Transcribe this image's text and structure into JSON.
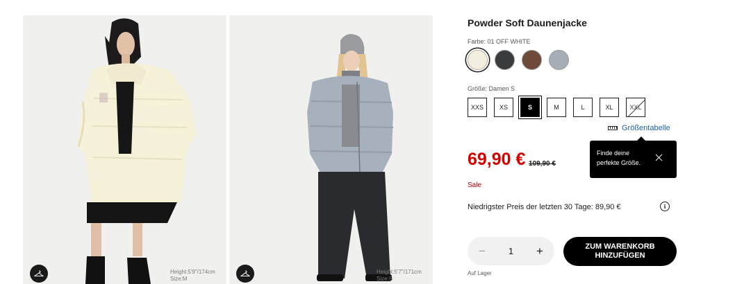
{
  "gallery": {
    "images": [
      {
        "model_height": "Height:5'9\"/174cm",
        "model_size": "Size:M"
      },
      {
        "model_height": "Height:5'7\"/171cm",
        "model_size": "Size:S"
      }
    ],
    "hanger_icon": "hanger-icon"
  },
  "product": {
    "title": "Powder Soft Daunenjacke",
    "color_label": "Farbe: 01 OFF WHITE",
    "colors": [
      {
        "name": "off-white",
        "hex": "#f2efe0",
        "selected": true
      },
      {
        "name": "dark-gray",
        "hex": "#3a3b3d",
        "selected": false
      },
      {
        "name": "brown",
        "hex": "#6e4a3b",
        "selected": false
      },
      {
        "name": "light-gray",
        "hex": "#a6adb6",
        "selected": false
      }
    ],
    "size_label": "Größe: Damen S",
    "sizes": [
      "XXS",
      "XS",
      "S",
      "M",
      "L",
      "XL",
      "XXL"
    ],
    "selected_size": "S",
    "unavailable_sizes": [
      "XXL"
    ],
    "size_guide_label": "Größentabelle",
    "tooltip": {
      "line1": "Finde deine",
      "line2": "perfekte Größe."
    },
    "price": "69,90 €",
    "old_price": "109,90 €",
    "sale_label": "Sale",
    "lowest_price_text": "Niedrigster Preis der letzten 30 Tage: 89,90 €",
    "info_glyph": "i",
    "quantity": "1",
    "minus": "−",
    "plus": "+",
    "cart_line1": "ZUM WARENKORB",
    "cart_line2": "HINZUFÜGEN",
    "stock_text": "Auf Lager"
  },
  "colors": {
    "price_red": "#d40000",
    "link_blue": "#1f5fa8",
    "sale_red": "#b30000"
  }
}
